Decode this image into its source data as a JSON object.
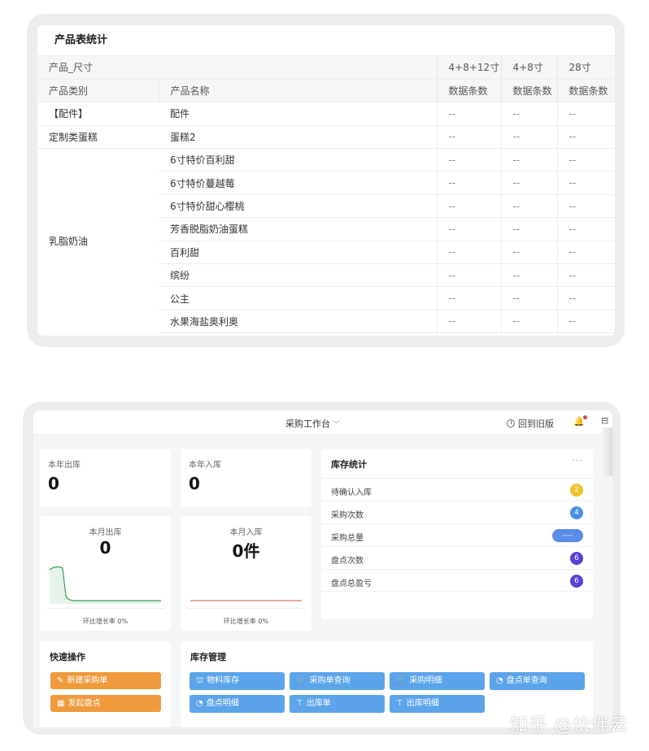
{
  "product_table": {
    "title": "产品表统计",
    "header_row1": [
      "产品_尺寸",
      "",
      "4+8+12寸",
      "4+8寸",
      "28寸"
    ],
    "header_row2": [
      "产品类别",
      "产品名称",
      "数据条数",
      "数据条数",
      "数据条数"
    ],
    "rows": [
      {
        "category": "【配件】",
        "name": "配件",
        "v1": "--",
        "v2": "--",
        "v3": "--"
      },
      {
        "category": "定制类蛋糕",
        "name": "蛋糕2",
        "v1": "--",
        "v2": "--",
        "v3": "--"
      },
      {
        "category": "",
        "name": "6寸特价百利甜",
        "v1": "--",
        "v2": "--",
        "v3": "--"
      },
      {
        "category": "",
        "name": "6寸特价蔓越莓",
        "v1": "--",
        "v2": "--",
        "v3": "--"
      },
      {
        "category": "",
        "name": "6寸特价甜心樱桃",
        "v1": "--",
        "v2": "--",
        "v3": "--"
      },
      {
        "category": "",
        "name": "芳香脱脂奶油蛋糕",
        "v1": "--",
        "v2": "--",
        "v3": "--"
      },
      {
        "category": "",
        "name": "百利甜",
        "v1": "--",
        "v2": "--",
        "v3": "--"
      },
      {
        "category": "",
        "name": "缤纷",
        "v1": "--",
        "v2": "--",
        "v3": "--"
      },
      {
        "category": "",
        "name": "公主",
        "v1": "--",
        "v2": "--",
        "v3": "--"
      },
      {
        "category": "",
        "name": "水果海盐奥利奥",
        "v1": "--",
        "v2": "--",
        "v3": "--"
      }
    ],
    "merged_category": "乳脂奶油"
  },
  "dashboard": {
    "topbar": {
      "workbench": "采购工作台",
      "back_old": "回到旧版"
    },
    "year_out": {
      "label": "本年出库",
      "value": "0"
    },
    "year_in": {
      "label": "本年入库",
      "value": "0"
    },
    "month_out": {
      "label": "本月出库",
      "value": "0",
      "ratio": "环比增长率 0%",
      "line_color": "#3f9a5b"
    },
    "month_in": {
      "label": "本月入库",
      "value": "0件",
      "ratio": "环比增长率 0%",
      "line_color": "#d9534f"
    },
    "stock": {
      "title": "库存统计",
      "more": "···",
      "rows": [
        {
          "label": "待确认入库",
          "badge": "2",
          "color": "#f2c12e"
        },
        {
          "label": "采购次数",
          "badge": "4",
          "color": "#4a90e2"
        },
        {
          "label": "采购总量",
          "badge": "----",
          "color": "#5b8de8"
        },
        {
          "label": "盘点次数",
          "badge": "6",
          "color": "#5a3fd6"
        },
        {
          "label": "盘点总盈亏",
          "badge": "6",
          "color": "#5a3fd6"
        }
      ]
    },
    "quick": {
      "title": "快速操作",
      "buttons": [
        "新建采购单",
        "发起盘点"
      ]
    },
    "mgmt": {
      "title": "库存管理",
      "buttons": [
        "物料库存",
        "采购单查询",
        "采购明细",
        "盘点单查询",
        "盘点明细",
        "出库单",
        "出库明细"
      ]
    }
  },
  "watermark": "知乎 @伙伴云"
}
